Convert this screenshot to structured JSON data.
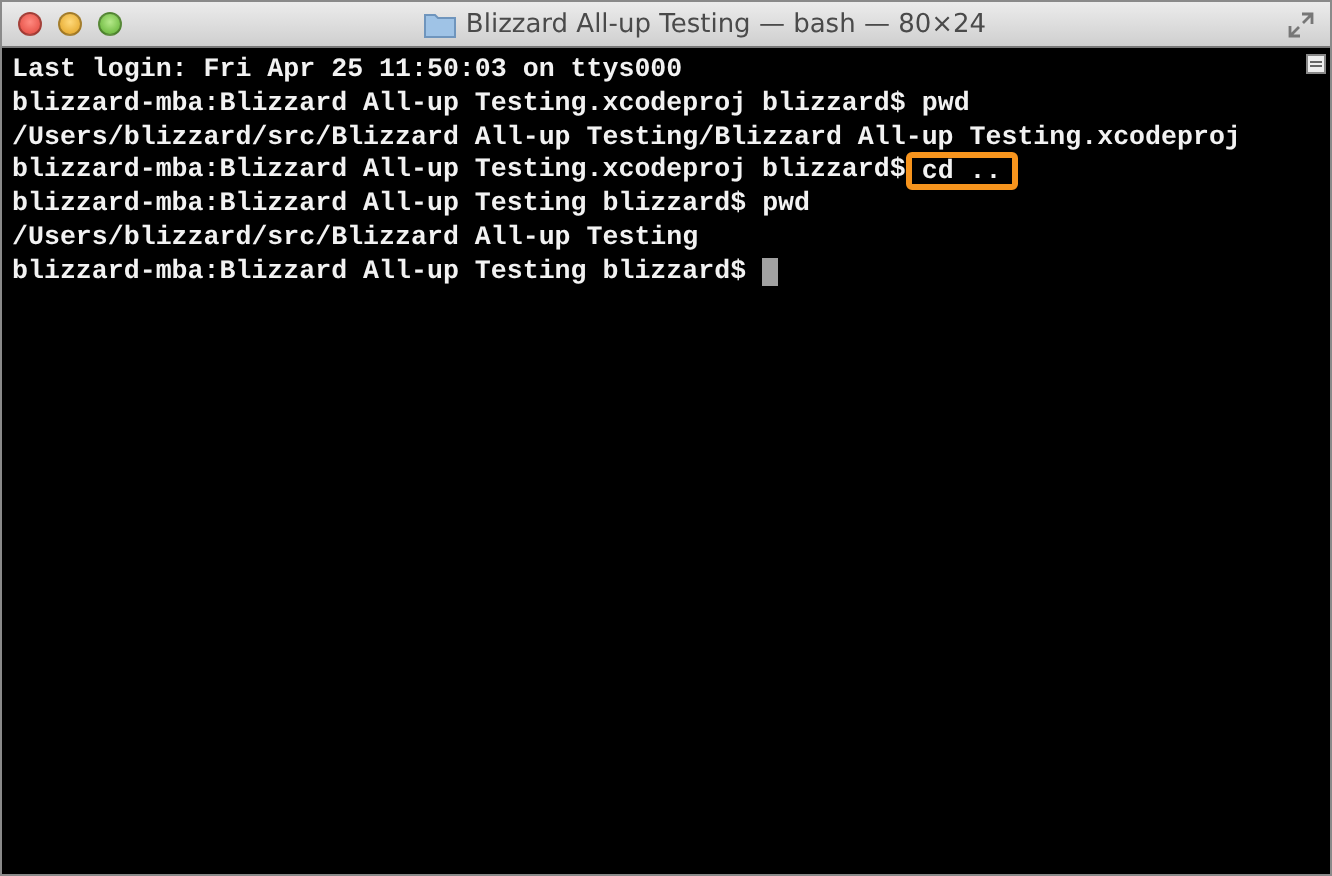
{
  "window": {
    "title": "Blizzard All-up Testing — bash — 80×24"
  },
  "lines": [
    {
      "kind": "output",
      "text": "Last login: Fri Apr 25 11:50:03 on ttys000"
    },
    {
      "kind": "prompt",
      "prompt": "blizzard-mba:Blizzard All-up Testing.xcodeproj blizzard$",
      "command": "pwd",
      "highlighted": false,
      "cursor": false
    },
    {
      "kind": "output",
      "text": "/Users/blizzard/src/Blizzard All-up Testing/Blizzard All-up Testing.xcodeproj"
    },
    {
      "kind": "prompt",
      "prompt": "blizzard-mba:Blizzard All-up Testing.xcodeproj blizzard$",
      "command": "cd ..",
      "highlighted": true,
      "cursor": false
    },
    {
      "kind": "prompt",
      "prompt": "blizzard-mba:Blizzard All-up Testing blizzard$",
      "command": "pwd",
      "highlighted": false,
      "cursor": false
    },
    {
      "kind": "output",
      "text": "/Users/blizzard/src/Blizzard All-up Testing"
    },
    {
      "kind": "prompt",
      "prompt": "blizzard-mba:Blizzard All-up Testing blizzard$",
      "highlighted": false,
      "cursor": true
    }
  ]
}
